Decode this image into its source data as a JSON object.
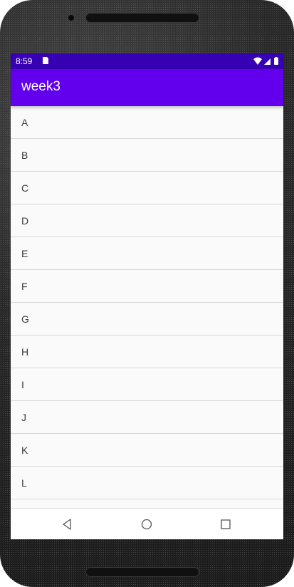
{
  "status_bar": {
    "time": "8:59",
    "icons": [
      "sd-card-icon",
      "wifi-icon",
      "cell-signal-icon",
      "battery-icon"
    ]
  },
  "app_bar": {
    "title": "week3",
    "color": "#6200ee",
    "status_color": "#3700b3"
  },
  "list": {
    "items": [
      "A",
      "B",
      "C",
      "D",
      "E",
      "F",
      "G",
      "H",
      "I",
      "J",
      "K",
      "L"
    ]
  },
  "nav_bar": {
    "buttons": [
      "back-icon",
      "home-icon",
      "recents-icon"
    ]
  }
}
